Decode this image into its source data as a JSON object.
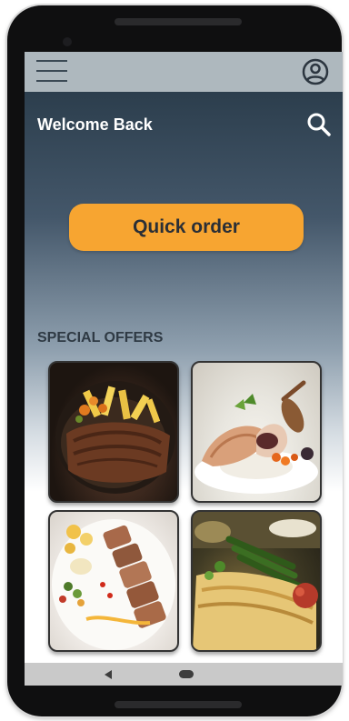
{
  "header": {
    "menu_icon": "hamburger-menu-icon",
    "profile_icon": "account-circle-icon"
  },
  "main": {
    "welcome_text": "Welcome Back",
    "search_icon": "search-icon",
    "quick_order_label": "Quick order",
    "special_offers_title": "SPECIAL OFFERS",
    "offers": [
      {
        "image": "steak-with-fries-and-vegetables"
      },
      {
        "image": "stuffed-chicken-plate"
      },
      {
        "image": "grilled-meat-skewers-plate"
      },
      {
        "image": "grilled-platter-with-vegetables"
      }
    ]
  },
  "colors": {
    "accent": "#f7a531",
    "header_bg": "#aeb8be",
    "gradient_top": "#2c3e4d"
  },
  "navbar": {
    "back_icon": "back-triangle-icon",
    "home_icon": "home-pill-icon"
  }
}
